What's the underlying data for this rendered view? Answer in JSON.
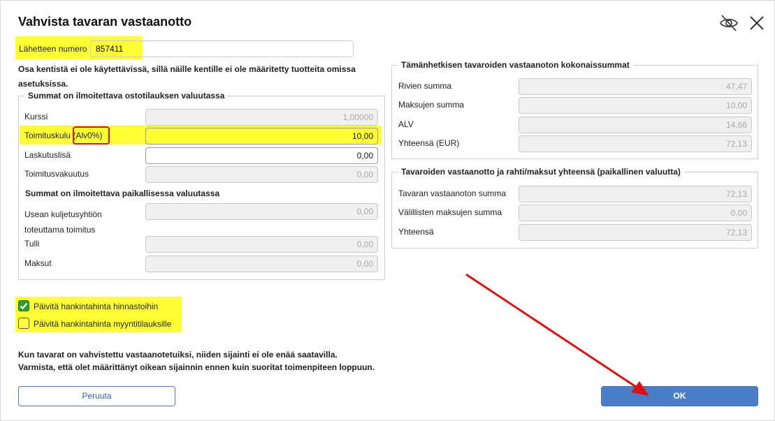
{
  "dialog": {
    "title": "Vahvista tavaran vastaanotto",
    "hide_icon": "eye-slash-icon",
    "close_icon": "close-icon"
  },
  "sender": {
    "label": "Lähetteen numero",
    "value": "857411"
  },
  "note": "Osa kentistä ei ole käytettävissä, sillä näille kentille ei ole määritetty tuotteita omissa asetuksissa.",
  "left_group": {
    "legend": "Summat on ilmoitettava ostotilauksen valuutassa",
    "rows": [
      {
        "label": "Kurssi",
        "value": "1,00000"
      },
      {
        "label": "Toimituskulu",
        "label_suffix": "(Alv0%)",
        "value": "10,00"
      },
      {
        "label": "Laskutuslisä",
        "value": "0,00"
      },
      {
        "label": "Toimitusvakuutus",
        "value": "0,00"
      }
    ],
    "subheading": "Summat on ilmoitettava paikallisessa valuutassa",
    "local_rows": [
      {
        "label_line1": "Usean kuljetusyhtiön",
        "label_line2": "toteuttama toimitus",
        "value": "0,00"
      },
      {
        "label": "Tulli",
        "value": "0,00"
      },
      {
        "label": "Maksut",
        "value": "0,00"
      }
    ]
  },
  "right_group_1": {
    "legend": "Tämänhetkisen tavaroiden vastaanoton kokonaissummat",
    "rows": [
      {
        "label": "Rivien summa",
        "value": "47,47"
      },
      {
        "label": "Maksujen summa",
        "value": "10,00"
      },
      {
        "label": "ALV",
        "value": "14,66"
      },
      {
        "label": "Yhteensä (EUR)",
        "value": "72,13"
      }
    ]
  },
  "right_group_2": {
    "legend": "Tavaroiden vastaanotto ja rahti/maksut yhteensä (paikallinen valuutta)",
    "rows": [
      {
        "label": "Tavaran vastaanoton summa",
        "value": "72,13"
      },
      {
        "label": "Välillisten maksujen summa",
        "value": "0,00"
      },
      {
        "label": "Yhteensä",
        "value": "72,13"
      }
    ]
  },
  "checkboxes": [
    {
      "label": "Päivitä hankintahinta hinnastoihin",
      "checked": true
    },
    {
      "label": "Päivitä hankintahinta myyntitilauksille",
      "checked": false
    }
  ],
  "warning_line1": "Kun tavarat on vahvistettu vastaanotetuiksi, niiden sijainti ei ole enää saatavilla.",
  "warning_line2": "Varmista, että olet määrittänyt oikean sijainnin ennen kuin suoritat toimenpiteen loppuun.",
  "buttons": {
    "cancel": "Peruuta",
    "ok": "OK"
  },
  "colors": {
    "highlight": "#ffff33",
    "annotation_red": "#e01010",
    "ok_button": "#4a7fc7",
    "checkbox_checked": "#2e9e2e"
  }
}
